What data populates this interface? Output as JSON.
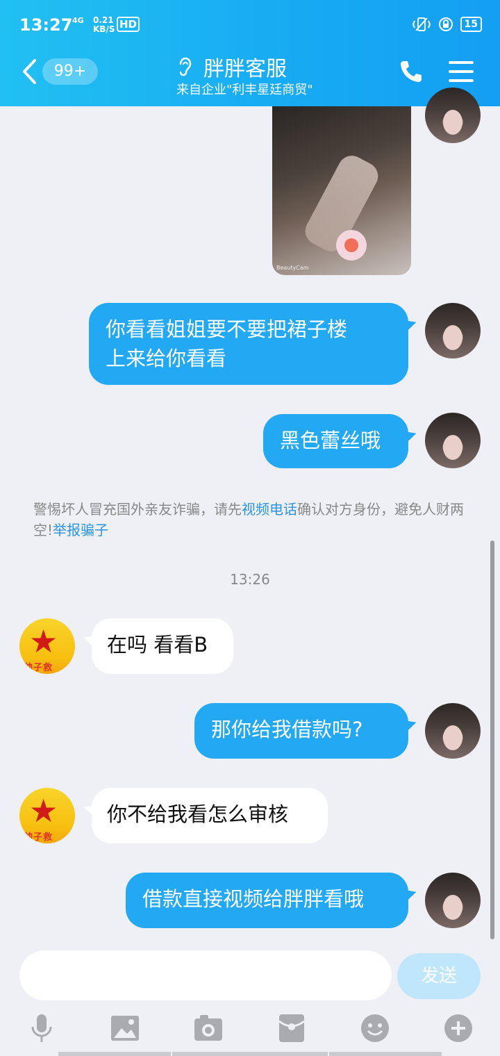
{
  "status_bar": {
    "time": "13:27",
    "net_type": "4G",
    "net_speed_value": "0.21",
    "net_speed_unit": "KB/S",
    "hd_label": "HD",
    "battery": "15"
  },
  "header": {
    "unread_count": "99+",
    "title": "胖胖客服",
    "subtitle": "来自企业\"利丰星廷商贸\""
  },
  "messages": {
    "m1": "你看看姐姐要不要把裙子楼上来给你看看",
    "m1_line1": "你看看姐姐要不要把裙子楼",
    "m1_line2": "上来给你看看",
    "m2": "黑色蕾丝哦",
    "m3": "在吗 看看B",
    "m4": "那你给我借款吗?",
    "m5": "你不给我看怎么审核",
    "m6": "借款直接视频给胖胖看哦"
  },
  "photo_watermark": "BeautyCam",
  "avatar_seal_text": "帅子救",
  "warning": {
    "text_before": "警惕坏人冒充国外亲友诈骗，请先",
    "link_video": "视频电话",
    "text_after": "确认对方身份，避免人财两空!",
    "link_report": "举报骗子"
  },
  "time_divider": "13:26",
  "input": {
    "value": "",
    "send_label": "发送"
  },
  "colors": {
    "header_start": "#21c0f2",
    "header_end": "#139ff3",
    "bubble_out": "#23a8f4",
    "link": "#2a94e2"
  },
  "toolbar_icons": [
    "microphone-icon",
    "image-icon",
    "camera-icon",
    "red-packet-icon",
    "emoji-icon",
    "plus-icon"
  ]
}
